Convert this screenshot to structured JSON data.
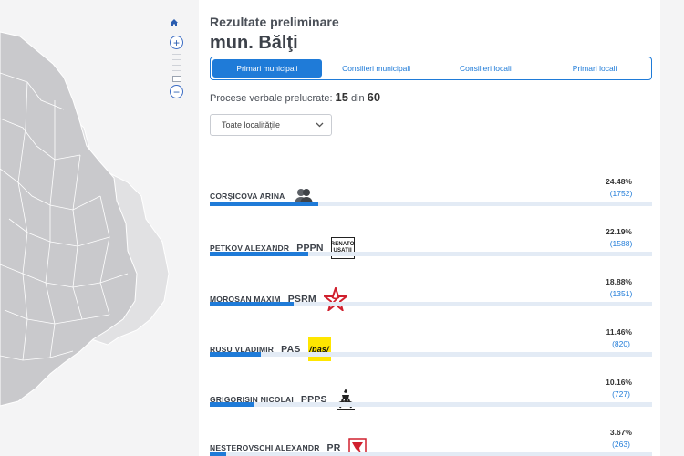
{
  "header": {
    "pre_title": "Rezultate preliminare",
    "city": "mun. Bălţi"
  },
  "tabs": [
    {
      "label": "Primari municipali",
      "active": true
    },
    {
      "label": "Consilieri municipali",
      "active": false
    },
    {
      "label": "Consilieri locali",
      "active": false
    },
    {
      "label": "Primari locali",
      "active": false
    }
  ],
  "progress": {
    "label": "Procese verbale prelucrate:",
    "processed": "15",
    "separator": "din",
    "total": "60"
  },
  "locality_select": {
    "value": "Toate localitățile"
  },
  "candidates": [
    {
      "name": "CORŞICOVA ARINA",
      "party": "",
      "logo": "independent-person-icon",
      "percent": "24.48%",
      "percent_value": 24.48,
      "votes": "(1752)"
    },
    {
      "name": "PETKOV ALEXANDR",
      "party": "PPPN",
      "logo": "pppn-logo",
      "logo_text": "RENATO USATII",
      "percent": "22.19%",
      "percent_value": 22.19,
      "votes": "(1588)"
    },
    {
      "name": "MOROŞAN MAXIM",
      "party": "PSRM",
      "logo": "psrm-star-logo",
      "percent": "18.88%",
      "percent_value": 18.88,
      "votes": "(1351)"
    },
    {
      "name": "RUSU VLADIMIR",
      "party": "PAS",
      "logo": "pas-logo",
      "logo_text": "/pas/",
      "percent": "11.46%",
      "percent_value": 11.46,
      "votes": "(820)"
    },
    {
      "name": "GRIGORIŞIN NICOLAI",
      "party": "PPPS",
      "logo": "ppps-logo",
      "percent": "10.16%",
      "percent_value": 10.16,
      "votes": "(727)"
    },
    {
      "name": "NESTEROVSCHI ALEXANDR",
      "party": "PR",
      "logo": "pr-logo",
      "percent": "3.67%",
      "percent_value": 3.67,
      "votes": "(263)"
    }
  ],
  "colors": {
    "accent": "#1f7bd8",
    "bar_track": "#e3ebf5",
    "psrm_red": "#d0202e",
    "pas_yellow": "#ffe600"
  }
}
